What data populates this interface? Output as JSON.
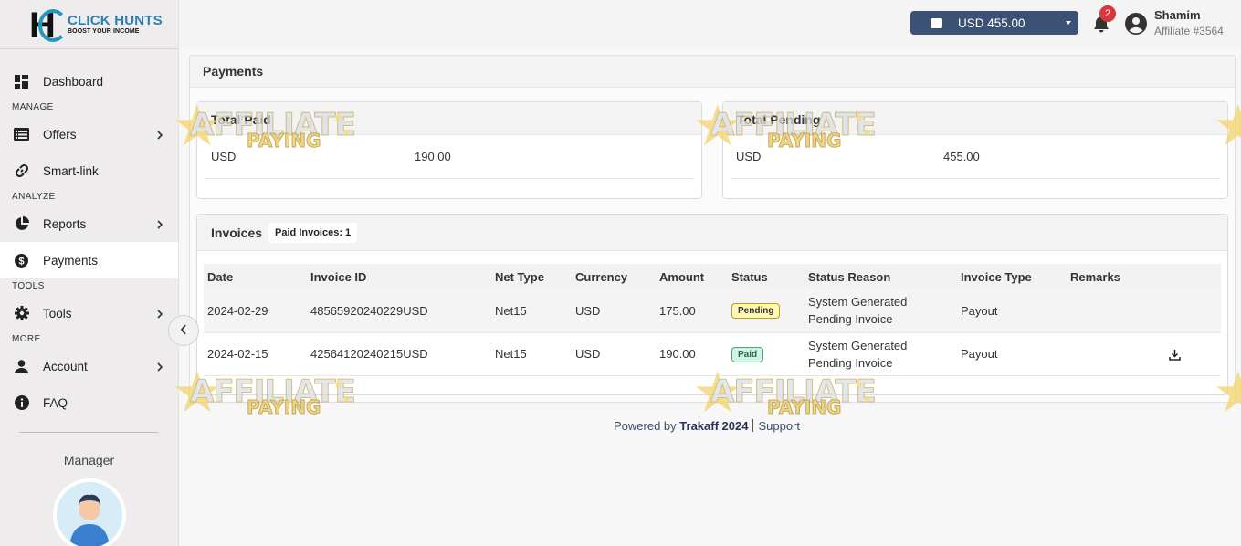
{
  "brand": {
    "line1": "CLICK HUNTS",
    "line2": "BOOST YOUR INCOME",
    "mark": "H"
  },
  "sidebar": {
    "items": [
      {
        "label": "Dashboard",
        "icon": "dashboard-icon"
      },
      {
        "section": "MANAGE"
      },
      {
        "label": "Offers",
        "icon": "list-icon"
      },
      {
        "label": "Smart-link",
        "icon": "link-icon"
      },
      {
        "section": "ANALYZE"
      },
      {
        "label": "Reports",
        "icon": "pie-chart-icon"
      },
      {
        "label": "Payments",
        "icon": "dollar-icon"
      },
      {
        "section": "TOOLS"
      },
      {
        "label": "Tools",
        "icon": "gear-icon"
      },
      {
        "section": "MORE"
      },
      {
        "label": "Account",
        "icon": "user-icon"
      },
      {
        "label": "FAQ",
        "icon": "info-icon"
      }
    ],
    "manager_label": "Manager"
  },
  "topbar": {
    "wallet_balance": "USD 455.00",
    "notification_count": "2",
    "user_name": "Shamim",
    "user_id": "Affiliate #3564"
  },
  "page": {
    "title": "Payments",
    "total_paid": {
      "title": "Total Paid",
      "currency": "USD",
      "amount": "190.00"
    },
    "total_pending": {
      "title": "Total Pending",
      "currency": "USD",
      "amount": "455.00"
    },
    "invoices": {
      "title": "Invoices",
      "badge": "Paid Invoices: 1",
      "columns": [
        "Date",
        "Invoice ID",
        "Net Type",
        "Currency",
        "Amount",
        "Status",
        "Status Reason",
        "Invoice Type",
        "Remarks"
      ],
      "rows": [
        {
          "date": "2024-02-29",
          "invoice_id": "48565920240229USD",
          "net_type": "Net15",
          "currency": "USD",
          "amount": "175.00",
          "status": "Pending",
          "reason1": "System Generated",
          "reason2": "Pending Invoice",
          "type": "Payout",
          "remarks": ""
        },
        {
          "date": "2024-02-15",
          "invoice_id": "42564120240215USD",
          "net_type": "Net15",
          "currency": "USD",
          "amount": "190.00",
          "status": "Paid",
          "reason1": "System Generated",
          "reason2": "Pending Invoice",
          "type": "Payout",
          "remarks": ""
        }
      ]
    }
  },
  "footer": {
    "powered": "Powered by",
    "brand": "Trakaff 2024",
    "support": "Support"
  },
  "watermark": {
    "line1": "AFFILIATE",
    "line2": "PAYING"
  },
  "colors": {
    "wallet_bg": "#3c5275",
    "badge_red": "#d9363e",
    "brand_blue": "#2a7fb8",
    "pending_yellow": "#fff7b8",
    "paid_green": "#d4f2e4"
  }
}
